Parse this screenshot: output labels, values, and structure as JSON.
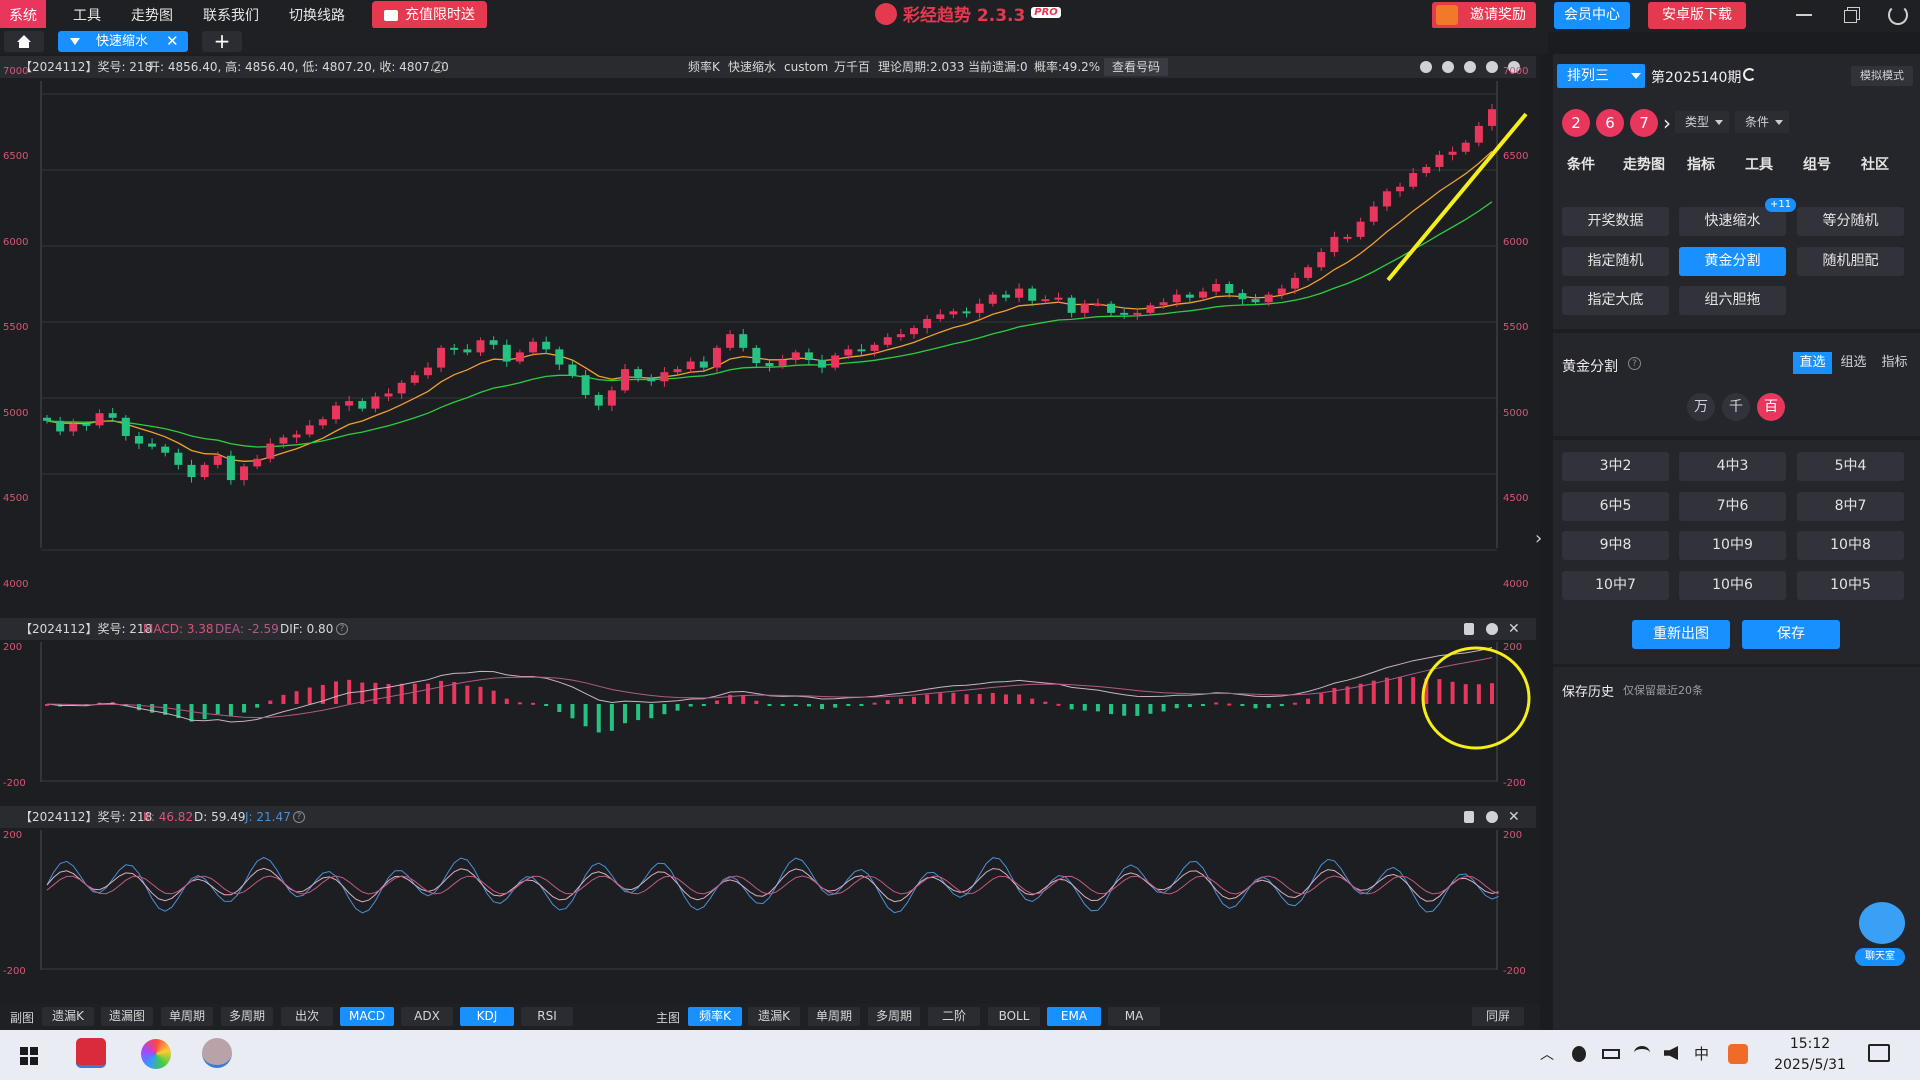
{
  "app": {
    "title": "彩经趋势 2.3.3",
    "badge": "PRO"
  },
  "menu": [
    "系统",
    "工具",
    "走势图",
    "联系我们",
    "切换线路"
  ],
  "promo": "充值限时送",
  "topright": {
    "invite": "邀请奖励",
    "member": "会员中心",
    "android": "安卓版下载"
  },
  "tabs": {
    "active": "快速缩水"
  },
  "main_title": {
    "period": "【2024112】奖号: 218",
    "ohlc": "开: 4856.40, 高: 4856.40, 低: 4807.20, 收: 4807.20",
    "info": [
      "频率K",
      "快速缩水",
      "custom",
      "万千百",
      "理论周期:2.033",
      "当前遗漏:0",
      "概率:49.2%"
    ],
    "button": "查看号码"
  },
  "main_axis": [
    "7000",
    "6500",
    "6000",
    "5500",
    "5000",
    "4500",
    "4000"
  ],
  "macd_title": {
    "prefix": "【2024112】奖号: 218",
    "macd": "MACD: 3.38",
    "dea": "DEA: -2.59",
    "dif": "DIF: 0.80"
  },
  "macd_axis": [
    "200",
    "-200"
  ],
  "kdj_title": {
    "prefix": "【2024112】奖号: 218",
    "k": "K: 46.82",
    "d": "D: 59.49",
    "j": "J: 21.47"
  },
  "kdj_axis": [
    "200",
    "-200"
  ],
  "bottombar": {
    "sub_label": "副图",
    "sub": [
      "遗漏K",
      "遗漏图",
      "单周期",
      "多周期",
      "出次",
      "MACD",
      "ADX",
      "KDJ",
      "RSI"
    ],
    "sub_active": [
      "MACD",
      "KDJ"
    ],
    "main_label": "主图",
    "main": [
      "频率K",
      "遗漏K",
      "单周期",
      "多周期",
      "二阶",
      "BOLL",
      "EMA",
      "MA"
    ],
    "main_active": [
      "频率K",
      "EMA"
    ],
    "same_screen": "同屏"
  },
  "right": {
    "lottery": "排列三",
    "issue": "第2025140期",
    "sim_mode": "模拟模式",
    "balls": [
      "2",
      "6",
      "7"
    ],
    "dd_type": "类型",
    "dd_cond": "条件",
    "nav": [
      "条件",
      "走势图",
      "指标",
      "工具",
      "组号",
      "社区"
    ],
    "tools": [
      "开奖数据",
      "快速缩水",
      "等分随机",
      "指定随机",
      "黄金分割",
      "随机胆配",
      "指定大底",
      "组六胆拖"
    ],
    "tools_badge": "+11",
    "tools_active": "黄金分割",
    "section": "黄金分割",
    "modes": [
      "直选",
      "组选",
      "指标"
    ],
    "mode_active": "直选",
    "digits": [
      "万",
      "千",
      "百"
    ],
    "digit_active": "百",
    "combos": [
      "3中2",
      "4中3",
      "5中4",
      "6中5",
      "7中6",
      "8中7",
      "9中8",
      "10中9",
      "10中8",
      "10中7",
      "10中6",
      "10中5"
    ],
    "redraw": "重新出图",
    "save": "保存",
    "history": "保存历史",
    "history_note": "仅保留最近20条",
    "chat": "聊天室"
  },
  "taskbar": {
    "time": "15:12",
    "date": "2025/5/31",
    "ime": "中"
  },
  "colors": {
    "up": "#e8365d",
    "down": "#26c281",
    "accent": "#1890ff",
    "ema_fast": "#f0a030",
    "ema_slow": "#2ecc40",
    "annotation": "#f5ee1a"
  },
  "chart_data": {
    "type": "candlestick",
    "y_range": [
      4000,
      7000
    ],
    "x_range_note": "",
    "close_series": [
      4850,
      4780,
      4830,
      4820,
      4900,
      4870,
      4750,
      4700,
      4680,
      4640,
      4560,
      4480,
      4560,
      4620,
      4460,
      4550,
      4600,
      4700,
      4740,
      4760,
      4820,
      4860,
      4950,
      4980,
      4930,
      5010,
      5030,
      5100,
      5150,
      5200,
      5330,
      5320,
      5300,
      5380,
      5350,
      5240,
      5300,
      5370,
      5320,
      5220,
      5150,
      5020,
      4950,
      5050,
      5190,
      5130,
      5110,
      5170,
      5190,
      5240,
      5200,
      5330,
      5420,
      5330,
      5230,
      5210,
      5250,
      5300,
      5250,
      5200,
      5280,
      5320,
      5310,
      5350,
      5400,
      5420,
      5460,
      5520,
      5550,
      5570,
      5560,
      5620,
      5680,
      5660,
      5720,
      5640,
      5650,
      5660,
      5560,
      5620,
      5620,
      5560,
      5550,
      5560,
      5610,
      5630,
      5680,
      5660,
      5700,
      5750,
      5690,
      5650,
      5630,
      5680,
      5720,
      5790,
      5860,
      5960,
      6060,
      6060,
      6160,
      6260,
      6360,
      6390,
      6480,
      6520,
      6600,
      6620,
      6680,
      6790,
      6900
    ]
  }
}
